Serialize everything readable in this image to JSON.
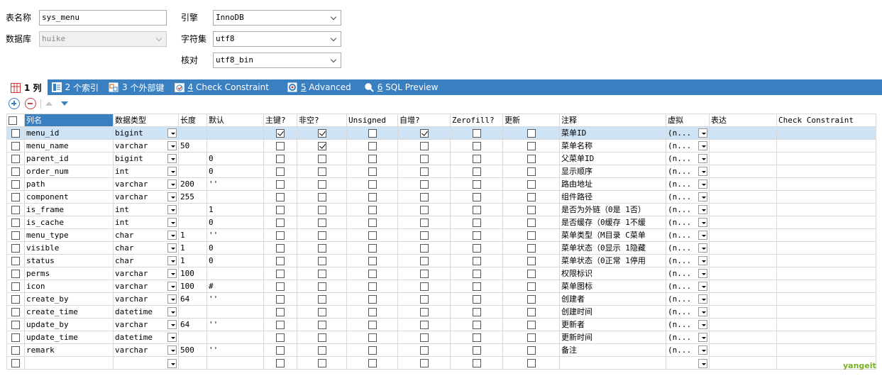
{
  "form": {
    "table_name_label": "表名称",
    "table_name_value": "sys_menu",
    "database_label": "数据库",
    "database_value": "huike",
    "engine_label": "引擎",
    "engine_value": "InnoDB",
    "charset_label": "字符集",
    "charset_value": "utf8",
    "collation_label": "核对",
    "collation_value": "utf8_bin"
  },
  "tabs": [
    {
      "num": "1",
      "label": "列",
      "icon": "columns-icon"
    },
    {
      "num": "2",
      "label": "个索引",
      "icon": "index-icon"
    },
    {
      "num": "3",
      "label": "个外部键",
      "icon": "foreign-key-icon"
    },
    {
      "num": "4",
      "label": "Check Constraint",
      "icon": "check-constraint-icon"
    },
    {
      "num": "5",
      "label": "Advanced",
      "icon": "advanced-icon"
    },
    {
      "num": "6",
      "label": "SQL Preview",
      "icon": "sql-preview-icon"
    }
  ],
  "headers": {
    "name": "列名",
    "type": "数据类型",
    "length": "长度",
    "default": "默认",
    "pk": "主键?",
    "not_null": "非空?",
    "unsigned": "Unsigned",
    "auto_inc": "自增?",
    "zerofill": "Zerofill?",
    "on_update": "更新",
    "comment": "注释",
    "virtual": "虚拟",
    "expression": "表达",
    "check": "Check Constraint"
  },
  "virtual_value": "(n...",
  "rows": [
    {
      "name": "menu_id",
      "type": "bigint",
      "length": "",
      "default": "",
      "pk": true,
      "nn": true,
      "ai": true,
      "comment": "菜单ID"
    },
    {
      "name": "menu_name",
      "type": "varchar",
      "length": "50",
      "default": "",
      "pk": false,
      "nn": true,
      "ai": false,
      "comment": "菜单名称"
    },
    {
      "name": "parent_id",
      "type": "bigint",
      "length": "",
      "default": "0",
      "pk": false,
      "nn": false,
      "ai": false,
      "comment": "父菜单ID"
    },
    {
      "name": "order_num",
      "type": "int",
      "length": "",
      "default": "0",
      "pk": false,
      "nn": false,
      "ai": false,
      "comment": "显示顺序"
    },
    {
      "name": "path",
      "type": "varchar",
      "length": "200",
      "default": "''",
      "pk": false,
      "nn": false,
      "ai": false,
      "comment": "路由地址"
    },
    {
      "name": "component",
      "type": "varchar",
      "length": "255",
      "default": "",
      "pk": false,
      "nn": false,
      "ai": false,
      "comment": "组件路径"
    },
    {
      "name": "is_frame",
      "type": "int",
      "length": "",
      "default": "1",
      "pk": false,
      "nn": false,
      "ai": false,
      "comment": "是否为外链（0是 1否）"
    },
    {
      "name": "is_cache",
      "type": "int",
      "length": "",
      "default": "0",
      "pk": false,
      "nn": false,
      "ai": false,
      "comment": "是否缓存（0缓存 1不缓"
    },
    {
      "name": "menu_type",
      "type": "char",
      "length": "1",
      "default": "''",
      "pk": false,
      "nn": false,
      "ai": false,
      "comment": "菜单类型（M目录 C菜单"
    },
    {
      "name": "visible",
      "type": "char",
      "length": "1",
      "default": "0",
      "pk": false,
      "nn": false,
      "ai": false,
      "comment": "菜单状态（0显示 1隐藏"
    },
    {
      "name": "status",
      "type": "char",
      "length": "1",
      "default": "0",
      "pk": false,
      "nn": false,
      "ai": false,
      "comment": "菜单状态（0正常 1停用"
    },
    {
      "name": "perms",
      "type": "varchar",
      "length": "100",
      "default": "",
      "pk": false,
      "nn": false,
      "ai": false,
      "comment": "权限标识"
    },
    {
      "name": "icon",
      "type": "varchar",
      "length": "100",
      "default": "#",
      "pk": false,
      "nn": false,
      "ai": false,
      "comment": "菜单图标"
    },
    {
      "name": "create_by",
      "type": "varchar",
      "length": "64",
      "default": "''",
      "pk": false,
      "nn": false,
      "ai": false,
      "comment": "创建者"
    },
    {
      "name": "create_time",
      "type": "datetime",
      "length": "",
      "default": "",
      "pk": false,
      "nn": false,
      "ai": false,
      "comment": "创建时间"
    },
    {
      "name": "update_by",
      "type": "varchar",
      "length": "64",
      "default": "''",
      "pk": false,
      "nn": false,
      "ai": false,
      "comment": "更新者"
    },
    {
      "name": "update_time",
      "type": "datetime",
      "length": "",
      "default": "",
      "pk": false,
      "nn": false,
      "ai": false,
      "comment": "更新时间"
    },
    {
      "name": "remark",
      "type": "varchar",
      "length": "500",
      "default": "''",
      "pk": false,
      "nn": false,
      "ai": false,
      "comment": "备注"
    }
  ],
  "watermark": "yangeit",
  "colors": {
    "accent": "#3a7fbf",
    "selected_row": "#cfe3f7",
    "watermark": "#7ab020"
  }
}
